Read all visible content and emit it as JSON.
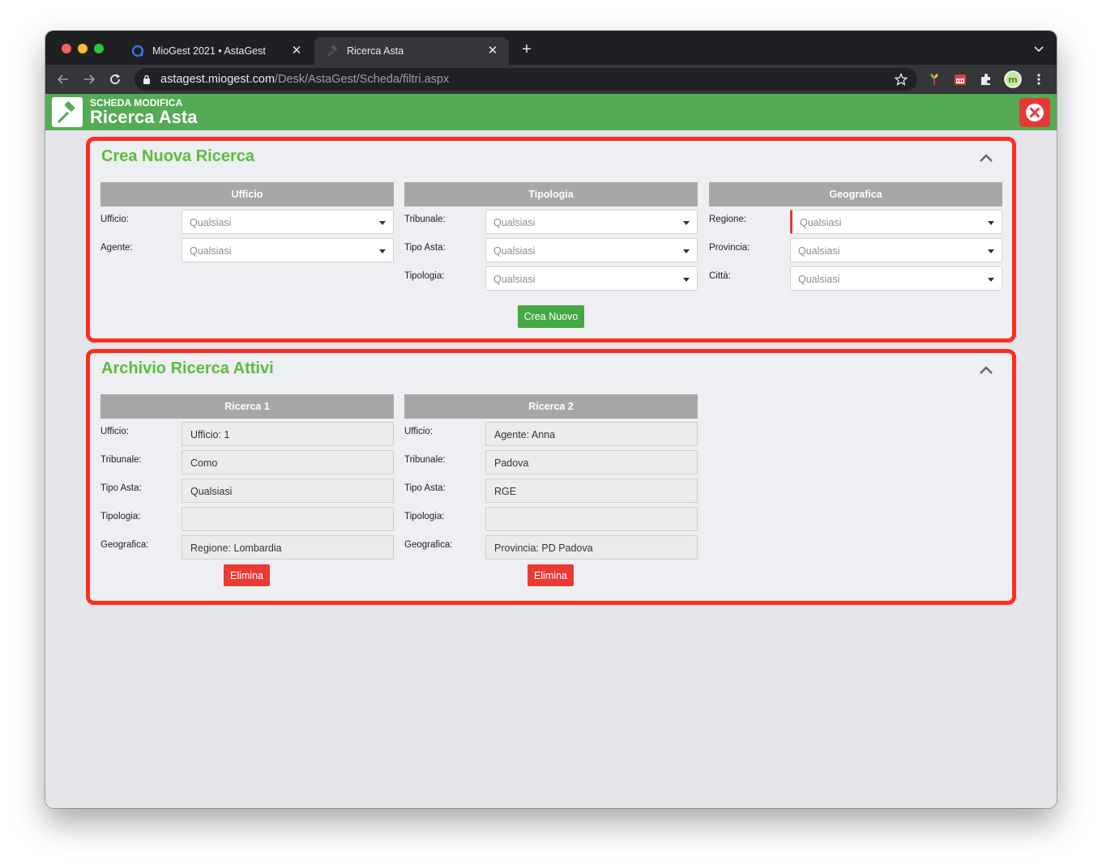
{
  "browser": {
    "tabs": [
      {
        "title": "MioGest 2021 • AstaGest",
        "active": false
      },
      {
        "title": "Ricerca Asta",
        "active": true
      }
    ],
    "url_host": "astagest.miogest.com",
    "url_path": "/Desk/AstaGest/Scheda/filtri.aspx"
  },
  "header": {
    "subtitle": "SCHEDA MODIFICA",
    "title": "Ricerca Asta",
    "color": "#55ab55"
  },
  "new_search": {
    "title": "Crea Nuova Ricerca",
    "columns": [
      {
        "heading": "Ufficio",
        "rows": [
          {
            "label": "Ufficio:",
            "value": "Qualsiasi"
          },
          {
            "label": "Agente:",
            "value": "Qualsiasi"
          }
        ]
      },
      {
        "heading": "Tipologia",
        "rows": [
          {
            "label": "Tribunale:",
            "value": "Qualsiasi"
          },
          {
            "label": "Tipo Asta:",
            "value": "Qualsiasi"
          },
          {
            "label": "Tipologia:",
            "value": "Qualsiasi"
          }
        ]
      },
      {
        "heading": "Geografica",
        "rows": [
          {
            "label": "Regione:",
            "value": "Qualsiasi"
          },
          {
            "label": "Provincia:",
            "value": "Qualsiasi"
          },
          {
            "label": "Città:",
            "value": "Qualsiasi"
          }
        ]
      }
    ],
    "create_button": "Crea Nuovo"
  },
  "archive": {
    "title": "Archivio Ricerca Attivi",
    "searches": [
      {
        "heading": "Ricerca 1",
        "rows": [
          {
            "label": "Ufficio:",
            "value": "Ufficio: 1"
          },
          {
            "label": "Tribunale:",
            "value": "Como"
          },
          {
            "label": "Tipo Asta:",
            "value": "Qualsiasi"
          },
          {
            "label": "Tipologia:",
            "value": ""
          },
          {
            "label": "Geografica:",
            "value": "Regione: Lombardia"
          }
        ],
        "delete_button": "Elimina"
      },
      {
        "heading": "Ricerca 2",
        "rows": [
          {
            "label": "Ufficio:",
            "value": "Agente: Anna"
          },
          {
            "label": "Tribunale:",
            "value": "Padova"
          },
          {
            "label": "Tipo Asta:",
            "value": "RGE"
          },
          {
            "label": "Tipologia:",
            "value": ""
          },
          {
            "label": "Geografica:",
            "value": "Provincia: PD Padova"
          }
        ],
        "delete_button": "Elimina"
      }
    ]
  },
  "accent_colors": {
    "title_green": "#5bbd3d",
    "highlight_red": "#ff2d1f",
    "delete_red": "#ea3b32",
    "create_green": "#45a845"
  }
}
